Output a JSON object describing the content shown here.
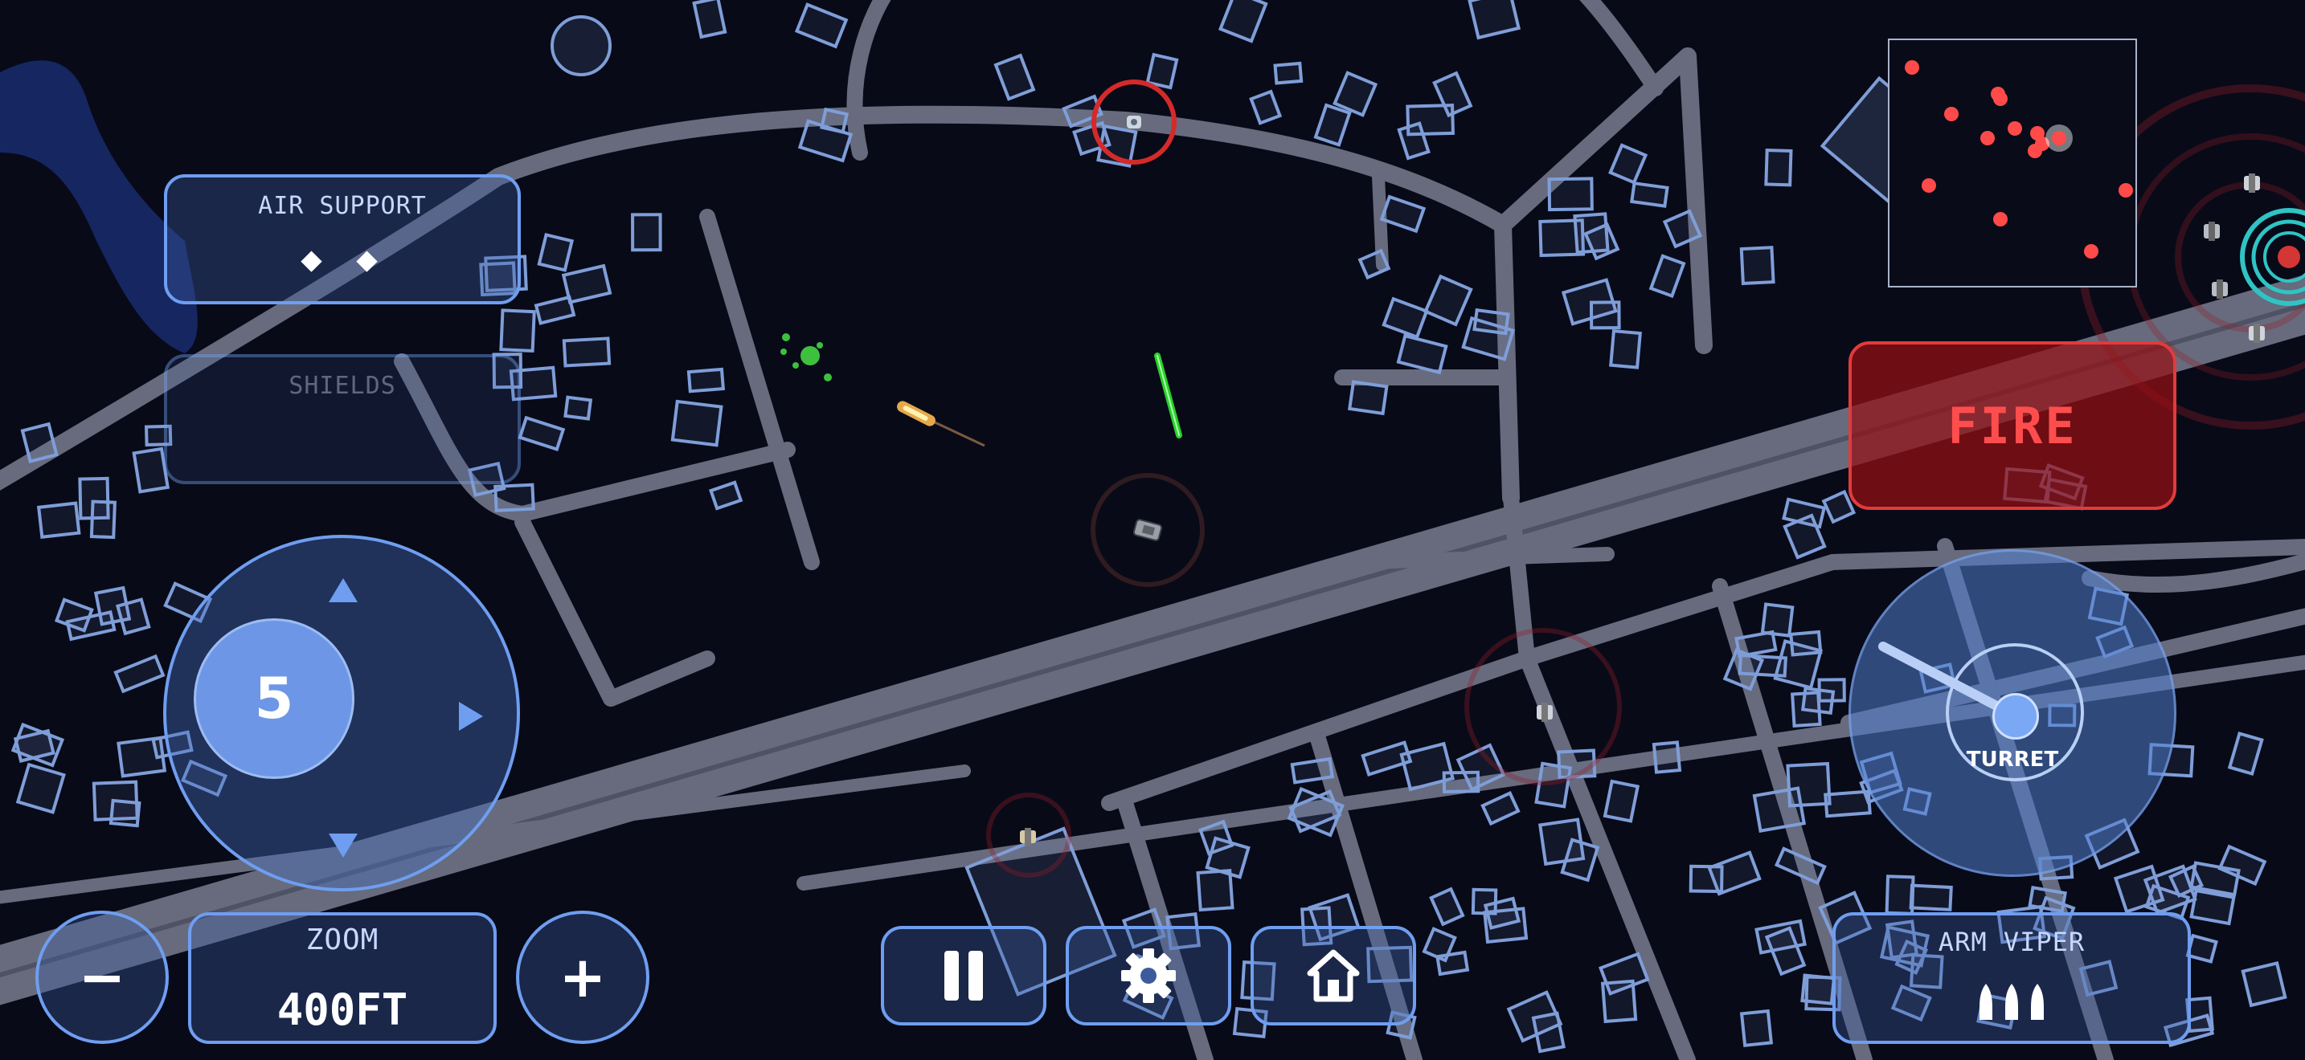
{
  "hud": {
    "air_support": {
      "title": "AIR SUPPORT",
      "pips": "◆ ◆"
    },
    "shields": {
      "title": "SHIELDS"
    },
    "movement_pad": {
      "value": "5"
    },
    "zoom": {
      "title": "ZOOM",
      "value": "400FT",
      "minus": "−",
      "plus": "+"
    },
    "controls": {
      "pause": "pause-icon",
      "settings": "gear-icon",
      "home": "home-icon"
    },
    "fire_button": {
      "label": "FIRE"
    },
    "turret": {
      "label": "TURRET"
    },
    "arm_weapon": {
      "title": "ARM VIPER",
      "ammo_count": 3
    }
  },
  "minimap": {
    "enemy_count": 13,
    "enemies": [
      [
        0.09,
        0.11
      ],
      [
        0.44,
        0.22
      ],
      [
        0.45,
        0.24
      ],
      [
        0.25,
        0.3
      ],
      [
        0.51,
        0.36
      ],
      [
        0.6,
        0.38
      ],
      [
        0.62,
        0.42
      ],
      [
        0.59,
        0.45
      ],
      [
        0.4,
        0.4
      ],
      [
        0.16,
        0.59
      ],
      [
        0.96,
        0.61
      ],
      [
        0.45,
        0.73
      ],
      [
        0.82,
        0.86
      ]
    ],
    "player": [
      0.69,
      0.4
    ]
  },
  "colors": {
    "background": "#080a18",
    "road": "#6b6f82",
    "building_outline": "#7f9ed8",
    "hud_accent": "#6f9ef0",
    "enemy": "#ff4a4a",
    "fire": "#e23b3b",
    "water": "#162660"
  }
}
